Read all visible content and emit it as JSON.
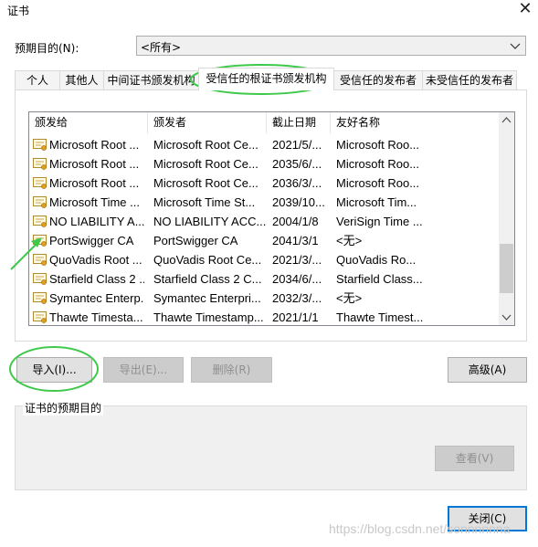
{
  "window": {
    "title": "证书"
  },
  "purpose": {
    "label": "预期目的(N):",
    "value": "<所有>"
  },
  "tabs": [
    {
      "label": "个人",
      "active": false
    },
    {
      "label": "其他人",
      "active": false
    },
    {
      "label": "中间证书颁发机构",
      "active": false
    },
    {
      "label": "受信任的根证书颁发机构",
      "active": true
    },
    {
      "label": "受信任的发布者",
      "active": false
    },
    {
      "label": "未受信任的发布者",
      "active": false
    }
  ],
  "list": {
    "columns": [
      "颁发给",
      "颁发者",
      "截止日期",
      "友好名称"
    ],
    "rows": [
      [
        "Microsoft Root ...",
        "Microsoft Root Ce...",
        "2021/5/...",
        "Microsoft Roo..."
      ],
      [
        "Microsoft Root ...",
        "Microsoft Root Ce...",
        "2035/6/...",
        "Microsoft Roo..."
      ],
      [
        "Microsoft Root ...",
        "Microsoft Root Ce...",
        "2036/3/...",
        "Microsoft Roo..."
      ],
      [
        "Microsoft Time ...",
        "Microsoft Time St...",
        "2039/10...",
        "Microsoft Tim..."
      ],
      [
        "NO LIABILITY A...",
        "NO LIABILITY ACC...",
        "2004/1/8",
        "VeriSign Time ..."
      ],
      [
        "PortSwigger CA",
        "PortSwigger CA",
        "2041/3/1",
        "<无>"
      ],
      [
        "QuoVadis Root ...",
        "QuoVadis Root Ce...",
        "2021/3/...",
        "QuoVadis Ro..."
      ],
      [
        "Starfield Class 2 ...",
        "Starfield Class 2 C...",
        "2034/6/...",
        "Starfield Class..."
      ],
      [
        "Symantec Enterp...",
        "Symantec Enterpri...",
        "2032/3/...",
        "<无>"
      ],
      [
        "Thawte Timesta...",
        "Thawte Timestamp...",
        "2021/1/1",
        "Thawte Timest..."
      ]
    ]
  },
  "buttons": {
    "import": "导入(I)...",
    "export": "导出(E)...",
    "remove": "删除(R)",
    "advanced": "高级(A)",
    "view": "查看(V)",
    "close": "关闭(C)"
  },
  "purpose_group": {
    "label": "证书的预期目的"
  },
  "watermark": "https://blog.csdn.net/sonnnnnna",
  "colors": {
    "annotation": "#3ec94a",
    "accent": "#0078d7"
  }
}
